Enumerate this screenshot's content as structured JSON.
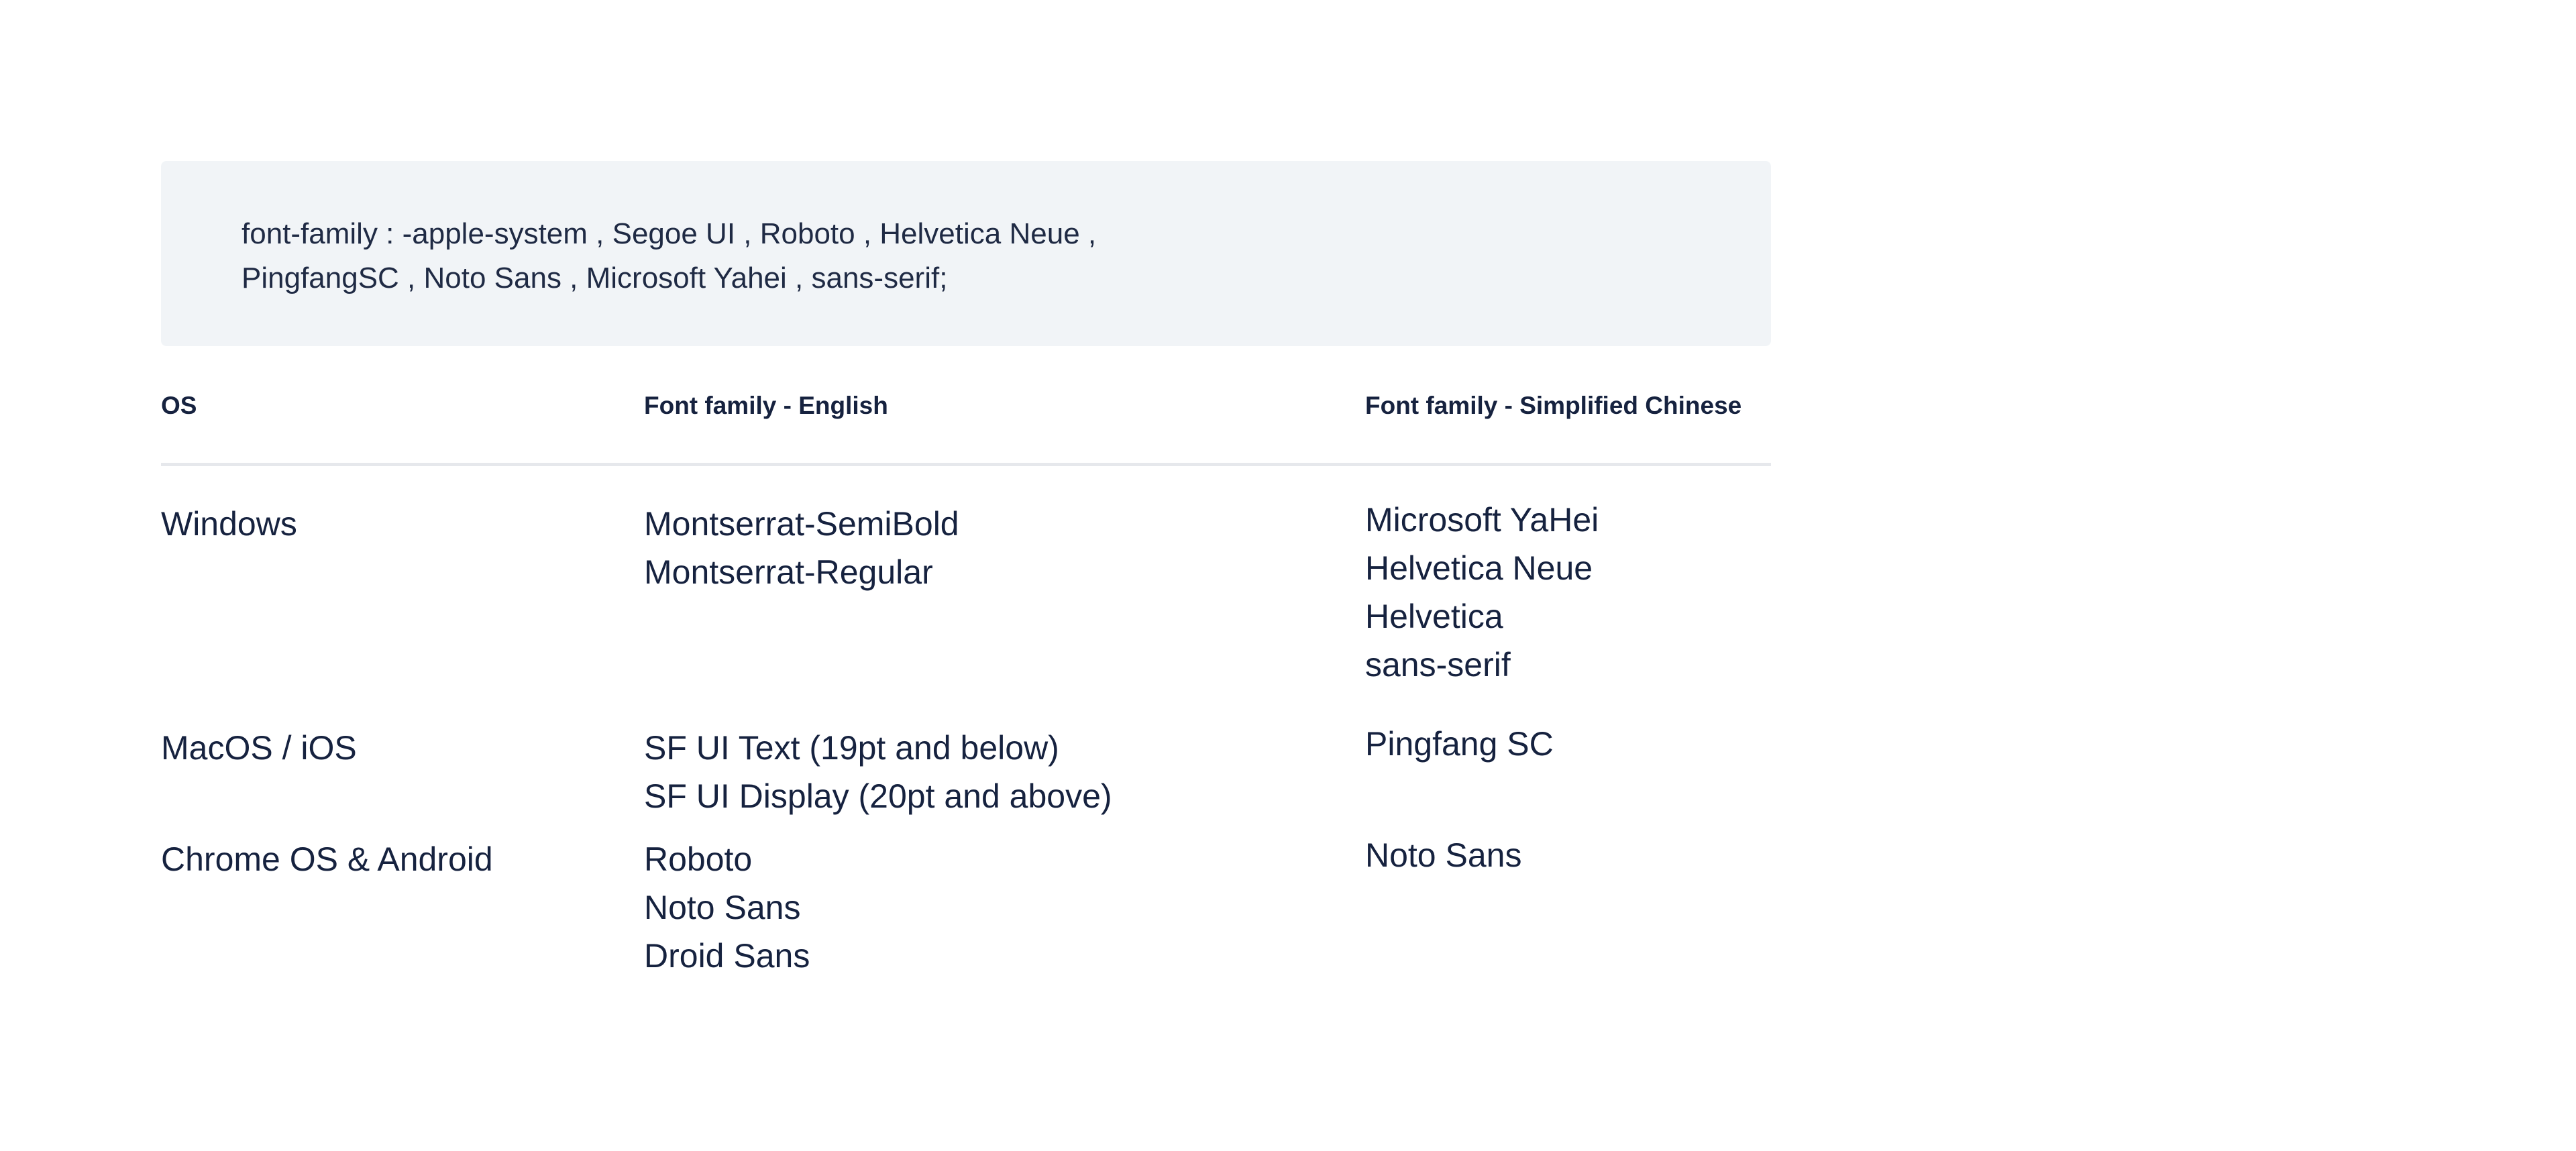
{
  "code_block": {
    "line1": "font-family :  -apple-system , Segoe UI , Roboto , Helvetica Neue ,",
    "line2": "PingfangSC , Noto Sans , Microsoft Yahei , sans-serif;"
  },
  "table": {
    "headers": {
      "os": "OS",
      "english": "Font family - English",
      "chinese": "Font family - Simplified Chinese"
    },
    "rows": [
      {
        "os": "Windows",
        "english": [
          "Montserrat-SemiBold",
          "Montserrat-Regular"
        ],
        "chinese": [
          "Microsoft YaHei",
          "Helvetica Neue",
          "Helvetica",
          "sans-serif"
        ]
      },
      {
        "os": "MacOS / iOS",
        "english": [
          "SF UI Text (19pt and below)",
          "SF UI Display (20pt and above)"
        ],
        "chinese": [
          "Pingfang SC"
        ]
      },
      {
        "os": "Chrome OS & Android",
        "english": [
          "Roboto",
          "Noto Sans",
          "Droid Sans"
        ],
        "chinese": [
          "Noto Sans"
        ]
      }
    ]
  },
  "colors": {
    "text": "#16223f",
    "code_background": "#f1f4f7",
    "divider": "#e6e8ec"
  }
}
